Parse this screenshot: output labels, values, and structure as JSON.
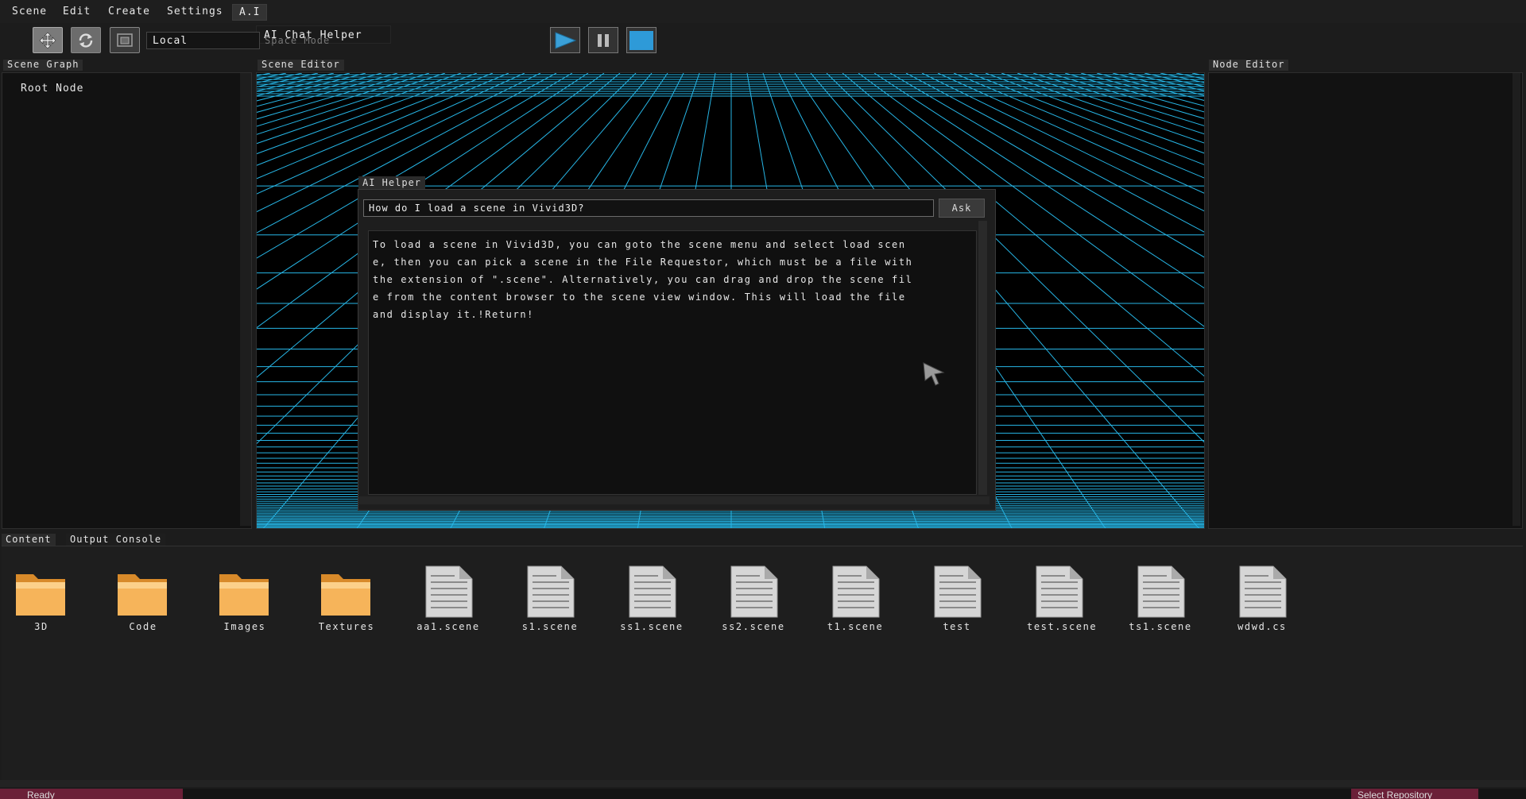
{
  "menu": {
    "items": [
      "Scene",
      "Edit",
      "Create",
      "Settings",
      "A.I"
    ],
    "ai_submenu_item": "AI Chat Helper"
  },
  "toolbar": {
    "tools": [
      {
        "name": "move",
        "icon": "move-arrows-icon",
        "selected": true
      },
      {
        "name": "rotate",
        "icon": "rotate-icon",
        "selected": false
      },
      {
        "name": "scale",
        "icon": "scale-icon",
        "selected": false
      }
    ],
    "coord_space": "Local",
    "coord_space_ghost": "Space Mode",
    "playback": {
      "play_icon": "play-icon",
      "pause_icon": "pause-icon",
      "stop_icon": "stop-icon"
    }
  },
  "panels": {
    "scene_graph": {
      "title": "Scene Graph",
      "root": "Root Node"
    },
    "scene_editor": {
      "title": "Scene Editor",
      "grid_color": "#27b6e6"
    },
    "node_editor": {
      "title": "Node Editor"
    }
  },
  "ai_helper": {
    "title": "AI Helper",
    "question": "How do I load a scene in Vivid3D?",
    "ask_label": "Ask",
    "answer": "To load a scene in Vivid3D, you can goto the scene menu and select load scene, then you can pick a scene in the File Requestor, which must be a file with the extension of \".scene\". Alternatively, you can drag and drop the scene file from the content browser to the scene view window. This will load the file and display it.!Return!"
  },
  "content_browser": {
    "tabs": [
      "Content",
      "Output Console"
    ],
    "items": [
      {
        "label": "3D",
        "type": "folder"
      },
      {
        "label": "Code",
        "type": "folder"
      },
      {
        "label": "Images",
        "type": "folder"
      },
      {
        "label": "Textures",
        "type": "folder"
      },
      {
        "label": "aa1.scene",
        "type": "file"
      },
      {
        "label": "s1.scene",
        "type": "file"
      },
      {
        "label": "ss1.scene",
        "type": "file"
      },
      {
        "label": "ss2.scene",
        "type": "file"
      },
      {
        "label": "t1.scene",
        "type": "file"
      },
      {
        "label": "test",
        "type": "file"
      },
      {
        "label": "test.scene",
        "type": "file"
      },
      {
        "label": "ts1.scene",
        "type": "file"
      },
      {
        "label": "wdwd.cs",
        "type": "file"
      }
    ]
  },
  "status": {
    "left": "Ready",
    "right": "Select Repository",
    "accent": "#6b2038"
  }
}
